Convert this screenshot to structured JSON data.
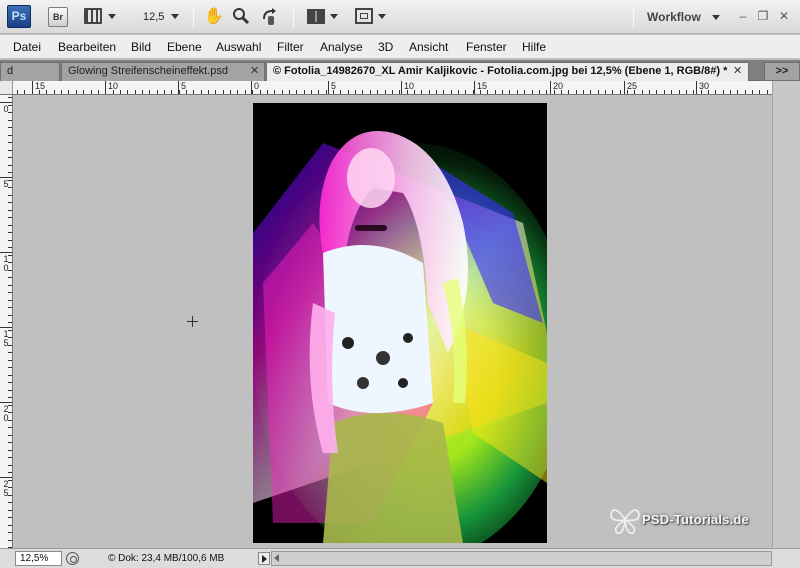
{
  "app": {
    "logo_text": "Ps",
    "bridge_label": "Br",
    "zoom_display": "12,5",
    "workspace_label": "Workflow",
    "window_controls": {
      "minimize": "–",
      "restore": "❐",
      "close": "✕"
    }
  },
  "menu": {
    "items": [
      "Datei",
      "Bearbeiten",
      "Bild",
      "Ebene",
      "Auswahl",
      "Filter",
      "Analyse",
      "3D",
      "Ansicht",
      "Fenster",
      "Hilfe"
    ]
  },
  "tabs": {
    "items": [
      {
        "label": "d",
        "active": false,
        "closable": false
      },
      {
        "label": "Glowing Streifenscheineffekt.psd",
        "active": false,
        "closable": true
      },
      {
        "label": "© Fotolia_14982670_XL Amir Kaljikovic - Fotolia.com.jpg bei 12,5% (Ebene 1, RGB/8#) *",
        "active": true,
        "closable": true
      }
    ],
    "close_glyph": "✕",
    "overflow_label": ">>"
  },
  "ruler": {
    "top_labels": [
      "15",
      "10",
      "5",
      "0",
      "5",
      "10",
      "15",
      "20",
      "25",
      "30"
    ],
    "left_labels": [
      "0",
      "5",
      "1 0",
      "1 5",
      "2 0",
      "2 5"
    ]
  },
  "canvas": {
    "watermark": "PSD-Tutorials.de"
  },
  "status": {
    "zoom_value": "12,5%",
    "doc_info": "© Dok: 23,4 MB/100,6 MB"
  },
  "icons": {
    "hand": "hand-icon",
    "zoom": "magnifier-icon",
    "rotate": "rotate-view-icon",
    "layout": "arrange-documents-icon",
    "screen": "screen-mode-icon"
  }
}
